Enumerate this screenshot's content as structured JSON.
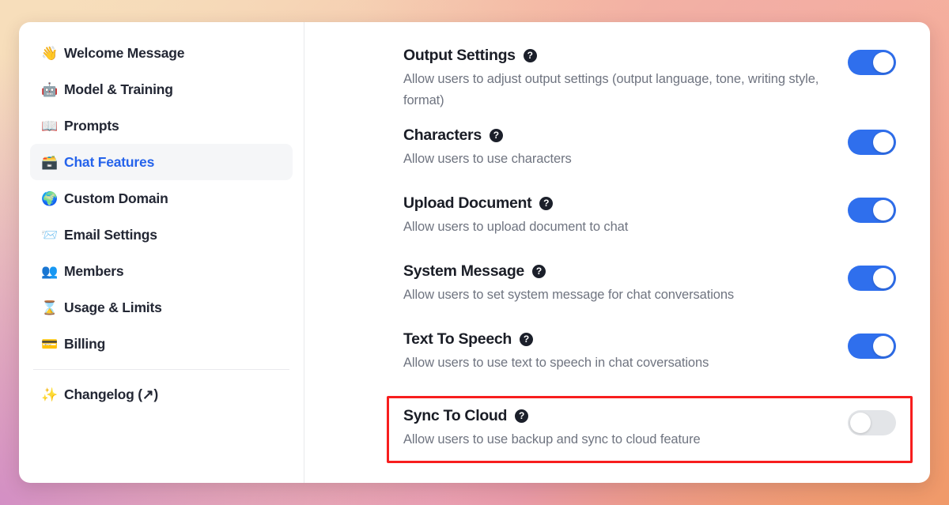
{
  "sidebar": {
    "items": [
      {
        "icon": "waving-hand-emoji",
        "glyph": "👋",
        "label": "Welcome Message",
        "active": false
      },
      {
        "icon": "robot-emoji",
        "glyph": "🤖",
        "label": "Model & Training",
        "active": false
      },
      {
        "icon": "open-book-emoji",
        "glyph": "📖",
        "label": "Prompts",
        "active": false
      },
      {
        "icon": "card-file-box-emoji",
        "glyph": "🗃️",
        "label": "Chat Features",
        "active": true
      },
      {
        "icon": "globe-emoji",
        "glyph": "🌍",
        "label": "Custom Domain",
        "active": false
      },
      {
        "icon": "incoming-envelope-emoji",
        "glyph": "📨",
        "label": "Email Settings",
        "active": false
      },
      {
        "icon": "busts-in-silhouette-emoji",
        "glyph": "👥",
        "label": "Members",
        "active": false
      },
      {
        "icon": "hourglass-emoji",
        "glyph": "⌛",
        "label": "Usage & Limits",
        "active": false
      },
      {
        "icon": "credit-card-emoji",
        "glyph": "💳",
        "label": "Billing",
        "active": false
      }
    ],
    "footer_items": [
      {
        "icon": "sparkles-emoji",
        "glyph": "✨",
        "label": "Changelog (↗)"
      }
    ]
  },
  "main": {
    "help_glyph": "?",
    "features": [
      {
        "title": "Output Settings",
        "description": "Allow users to adjust output settings (output language, tone, writing style, format)",
        "enabled": true,
        "highlighted": false
      },
      {
        "title": "Characters",
        "description": "Allow users to use characters",
        "enabled": true,
        "highlighted": false
      },
      {
        "title": "Upload Document",
        "description": "Allow users to upload document to chat",
        "enabled": true,
        "highlighted": false
      },
      {
        "title": "System Message",
        "description": "Allow users to set system message for chat conversations",
        "enabled": true,
        "highlighted": false
      },
      {
        "title": "Text To Speech",
        "description": "Allow users to use text to speech in chat coversations",
        "enabled": true,
        "highlighted": false
      },
      {
        "title": "Sync To Cloud",
        "description": "Allow users to use backup and sync to cloud feature",
        "enabled": false,
        "highlighted": true
      }
    ]
  },
  "colors": {
    "accent_blue": "#2563eb",
    "toggle_on": "#2f6fed",
    "toggle_off": "#e3e5e8",
    "highlight_red": "#f71e1e",
    "title_text": "#1a1d26",
    "desc_text": "#6f7480",
    "active_nav_bg": "#f5f6f8"
  }
}
